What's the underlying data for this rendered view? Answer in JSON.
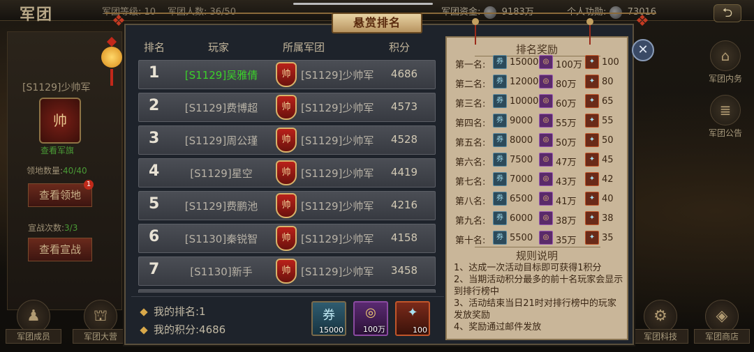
{
  "top": {
    "title": "军团",
    "legion_level": "军团等级: 10",
    "member_count": "军团人数: 36/50",
    "funds_label": "军团资金:",
    "funds_value": "9183万",
    "merit_label": "个人功勋:",
    "merit_value": "73016"
  },
  "left": {
    "legion_name": "[S1129]少帅军",
    "banner_glyph": "帅",
    "view_flag": "查看军旗",
    "territory_label": "领地数量:",
    "territory_value": "40/40",
    "view_territory": "查看领地",
    "territory_badge": "1",
    "declare_label": "宣战次数:",
    "declare_value": "3/3",
    "view_declare": "查看宣战"
  },
  "right_nav": [
    {
      "label": "军团内务",
      "icon": "⌂"
    },
    {
      "label": "军团公告",
      "icon": "≣"
    }
  ],
  "bottom_nav": [
    {
      "label": "军团成员",
      "icon": "♟"
    },
    {
      "label": "军团大营",
      "icon": "⛫"
    },
    {
      "label": "军团科技",
      "icon": "⚙"
    },
    {
      "label": "军团商店",
      "icon": "◈"
    }
  ],
  "modal": {
    "title": "悬赏排名",
    "close": "✕",
    "columns": {
      "rank": "排名",
      "player": "玩家",
      "guild": "所属军团",
      "score": "积分"
    },
    "rows": [
      {
        "rank": "1",
        "player": "[S1129]吴雅倩",
        "badge": "帅",
        "guild": "[S1129]少帅军",
        "score": "4686"
      },
      {
        "rank": "2",
        "player": "[S1129]费博超",
        "badge": "帅",
        "guild": "[S1129]少帅军",
        "score": "4573"
      },
      {
        "rank": "3",
        "player": "[S1129]周公瑾",
        "badge": "帅",
        "guild": "[S1129]少帅军",
        "score": "4528"
      },
      {
        "rank": "4",
        "player": "[S1129]星空",
        "badge": "帅",
        "guild": "[S1129]少帅军",
        "score": "4419"
      },
      {
        "rank": "5",
        "player": "[S1129]费鹏池",
        "badge": "帅",
        "guild": "[S1129]少帅军",
        "score": "4216"
      },
      {
        "rank": "6",
        "player": "[S1130]秦锐智",
        "badge": "帅",
        "guild": "[S1129]少帅军",
        "score": "4158"
      },
      {
        "rank": "7",
        "player": "[S1130]新手",
        "badge": "帅",
        "guild": "[S1129]少帅军",
        "score": "3458"
      }
    ],
    "my_rank": "我的排名:1",
    "my_score": "我的积分:4686",
    "my_rewards": [
      {
        "icon": "ticket-icon",
        "glyph": "券",
        "value": "15000"
      },
      {
        "icon": "coin-icon",
        "glyph": "◎",
        "value": "100万"
      },
      {
        "icon": "gem-icon",
        "glyph": "✦",
        "value": "100"
      }
    ]
  },
  "rewards_panel": {
    "title": "排名奖励",
    "rows": [
      {
        "place": "第一名:",
        "a": "15000",
        "b": "100万",
        "c": "100"
      },
      {
        "place": "第二名:",
        "a": "12000",
        "b": "80万",
        "c": "80"
      },
      {
        "place": "第三名:",
        "a": "10000",
        "b": "60万",
        "c": "65"
      },
      {
        "place": "第四名:",
        "a": "9000",
        "b": "55万",
        "c": "55"
      },
      {
        "place": "第五名:",
        "a": "8000",
        "b": "50万",
        "c": "50"
      },
      {
        "place": "第六名:",
        "a": "7500",
        "b": "47万",
        "c": "45"
      },
      {
        "place": "第七名:",
        "a": "7000",
        "b": "43万",
        "c": "42"
      },
      {
        "place": "第八名:",
        "a": "6500",
        "b": "41万",
        "c": "40"
      },
      {
        "place": "第九名:",
        "a": "6000",
        "b": "38万",
        "c": "38"
      },
      {
        "place": "第十名:",
        "a": "5500",
        "b": "35万",
        "c": "35"
      }
    ],
    "rules_title": "规则说明",
    "rules": [
      "1、达成一次活动目标即可获得1积分",
      "2、当期活动积分最多的前十名玩家会显示到排行榜中",
      "3、活动结束当日21时对排行榜中的玩家发放奖励",
      "4、奖励通过邮件发放"
    ]
  }
}
